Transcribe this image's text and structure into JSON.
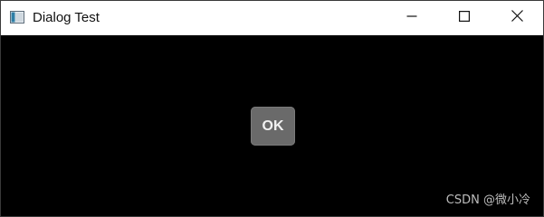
{
  "window": {
    "title": "Dialog Test",
    "icon": "app-window-icon",
    "controls": {
      "minimize_icon": "minimize-icon",
      "maximize_icon": "maximize-icon",
      "close_icon": "close-icon"
    }
  },
  "dialog": {
    "ok_label": "OK"
  },
  "watermark": {
    "text": "CSDN @微小冷"
  },
  "colors": {
    "titlebar": "#ffffff",
    "client_background": "#000000",
    "button_background": "#6a6a6a",
    "button_text": "#f2f2f2",
    "watermark_text": "#bdbdbd"
  }
}
